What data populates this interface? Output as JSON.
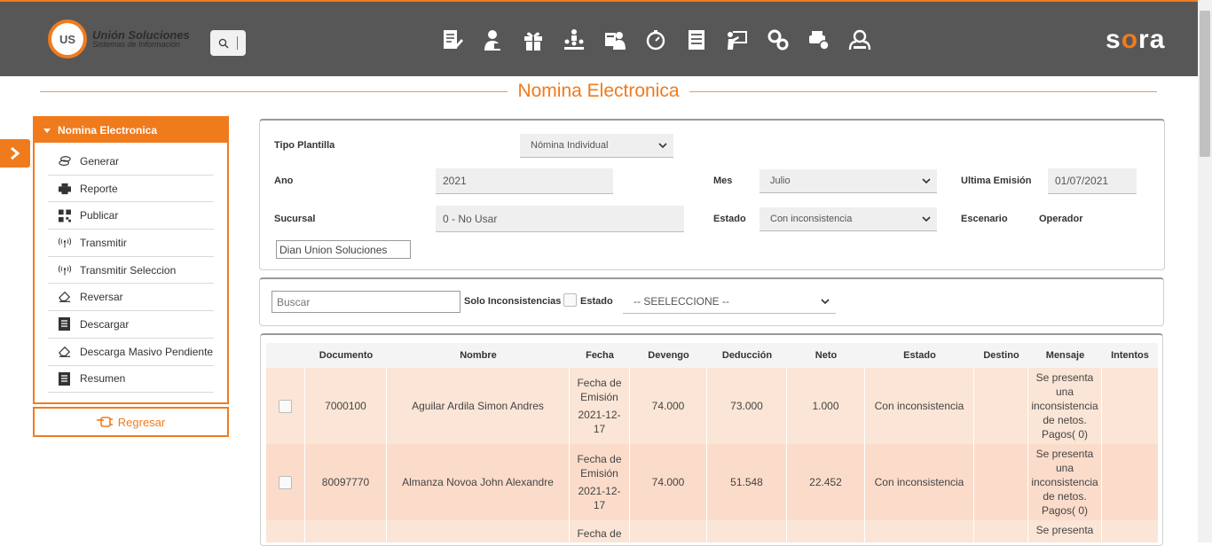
{
  "header": {
    "logo_title": "Unión Soluciones",
    "logo_subtitle": "Sistemas de Información",
    "logo_mark": "US",
    "brand_left": "s",
    "brand_mid": "o",
    "brand_right": "ra",
    "nav_icons": [
      "document-edit-icon",
      "user-worker-icon",
      "gift-icon",
      "org-chart-icon",
      "users-card-icon",
      "timer-icon",
      "report-list-icon",
      "presentation-icon",
      "gears-icon",
      "car-settings-icon",
      "users-search-icon"
    ]
  },
  "page": {
    "title": "Nomina Electronica"
  },
  "sidebar": {
    "title": "Nomina Electronica",
    "items": [
      {
        "label": "Generar",
        "icon": "coins-icon"
      },
      {
        "label": "Reporte",
        "icon": "printer-icon"
      },
      {
        "label": "Publicar",
        "icon": "qr-code-icon"
      },
      {
        "label": "Transmitir",
        "icon": "antenna-icon"
      },
      {
        "label": "Transmitir Seleccion",
        "icon": "antenna-icon"
      },
      {
        "label": "Reversar",
        "icon": "eraser-icon"
      },
      {
        "label": "Descargar",
        "icon": "document-icon"
      },
      {
        "label": "Descarga Masivo Pendiente",
        "icon": "eraser-icon"
      },
      {
        "label": "Resumen",
        "icon": "document-icon"
      }
    ],
    "back_label": "Regresar"
  },
  "form": {
    "tipo_plantilla_label": "Tipo Plantilla",
    "tipo_plantilla_value": "Nómina Individual",
    "ano_label": "Ano",
    "ano_value": "2021",
    "mes_label": "Mes",
    "mes_value": "Julio",
    "ultima_emision_label": "Ultima Emisión",
    "ultima_emision_value": "01/07/2021",
    "sucursal_label": "Sucursal",
    "sucursal_value": "0 - No Usar",
    "estado_label": "Estado",
    "estado_value": "Con inconsistencia",
    "escenario_label": "Escenario",
    "escenario_value": "Operador",
    "empresa_value": "Dian Union Soluciones"
  },
  "filter": {
    "search_placeholder": "Buscar",
    "solo_label": "Solo Inconsistencias",
    "estado_label": "Estado",
    "estado_value": "-- SEELECCIONE --"
  },
  "table": {
    "columns": [
      "Documento",
      "Nombre",
      "Fecha",
      "Devengo",
      "Deducción",
      "Neto",
      "Estado",
      "Destino",
      "Mensaje",
      "Intentos"
    ],
    "rows": [
      {
        "documento": "7000100",
        "nombre": "Aguilar Ardila Simon Andres",
        "fecha_label": "Fecha de Emisión",
        "fecha": "2021-12-17",
        "devengo": "74.000",
        "deduccion": "73.000",
        "neto": "1.000",
        "estado": "Con inconsistencia",
        "destino": "",
        "mensaje": "Se presenta una inconsistencia de netos. Pagos( 0)",
        "intentos": ""
      },
      {
        "documento": "80097770",
        "nombre": "Almanza Novoa John Alexandre",
        "fecha_label": "Fecha de Emisión",
        "fecha": "2021-12-17",
        "devengo": "74.000",
        "deduccion": "51.548",
        "neto": "22.452",
        "estado": "Con inconsistencia",
        "destino": "",
        "mensaje": "Se presenta una inconsistencia de netos. Pagos( 0)",
        "intentos": ""
      },
      {
        "documento": "",
        "nombre": "",
        "fecha_label": "Fecha de",
        "fecha": "",
        "devengo": "",
        "deduccion": "",
        "neto": "",
        "estado": "",
        "destino": "",
        "mensaje": "Se presenta",
        "intentos": ""
      }
    ]
  },
  "colors": {
    "accent": "#f07b1d",
    "header_bg": "#575757",
    "row_a": "#fbe5d6",
    "row_b": "#fbdccb"
  }
}
